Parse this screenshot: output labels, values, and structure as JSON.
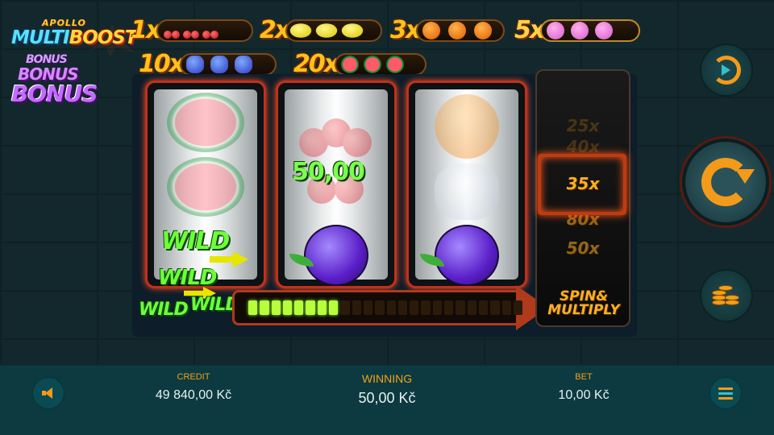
{
  "logo": {
    "top": "APOLLO",
    "multi": "MULTI",
    "boost": "BOOST"
  },
  "paytable": [
    {
      "mult": "1x",
      "fruit": "cherry"
    },
    {
      "mult": "2x",
      "fruit": "lemon"
    },
    {
      "mult": "3x",
      "fruit": "orange"
    },
    {
      "mult": "5x",
      "fruit": "plum"
    },
    {
      "mult": "10x",
      "fruit": "grape"
    },
    {
      "mult": "20x",
      "fruit": "melon"
    }
  ],
  "reels": {
    "win_amount": "50,00",
    "wild_label": "WILD"
  },
  "progress": {
    "filled": 8,
    "total": 24
  },
  "bonus": {
    "titles": [
      "BONUS",
      "BONUS",
      "BONUS"
    ],
    "multipliers": [
      "25x",
      "40x",
      "35x",
      "80x",
      "50x"
    ],
    "selected": "35x",
    "spin_multiply": [
      "SPIN&",
      "MULTIPLY"
    ]
  },
  "bottom_bar": {
    "credit_label": "CREDIT",
    "credit_value": "49 840,00 Kč",
    "winning_label": "WINNING",
    "winning_value": "50,00 Kč",
    "bet_label": "BET",
    "bet_value": "10,00 Kč"
  },
  "icons": {
    "sound": "speaker-icon",
    "menu": "menu-icon",
    "autoplay": "autoplay-icon",
    "spin": "spin-icon",
    "bet": "coins-icon"
  },
  "colors": {
    "accent": "#f49a1a",
    "win_green": "#7dff4a",
    "bar_bg": "#0c3a40",
    "reel_border": "#c0311c"
  }
}
